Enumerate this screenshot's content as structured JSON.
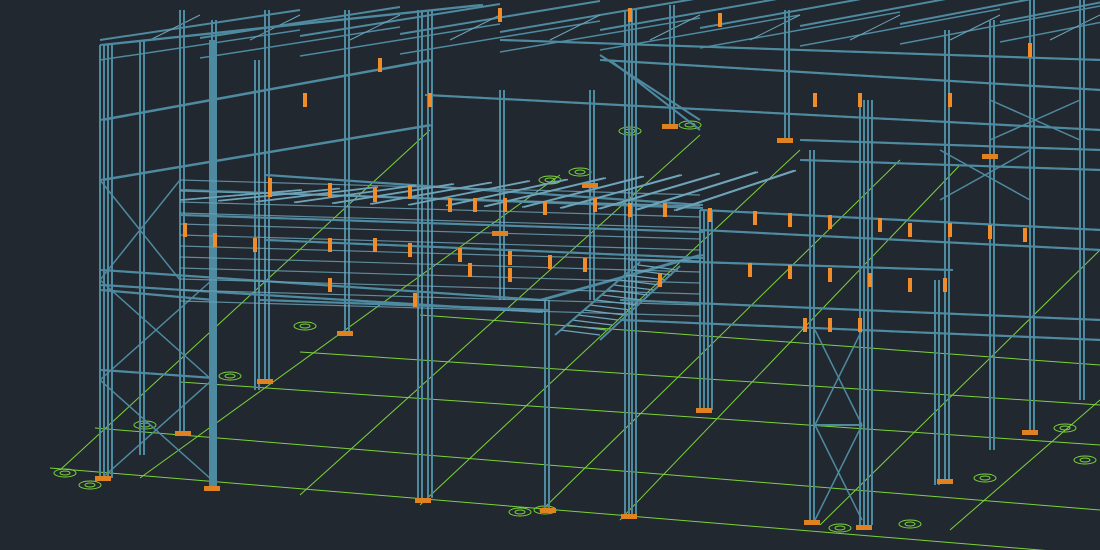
{
  "viewport": {
    "background": "#212830",
    "colors": {
      "steel": "#4e8aa0",
      "steel_light": "#6fa4b8",
      "grid": "#7bd33a",
      "base_plate": "#e0821f",
      "connection": "#f08c2a"
    },
    "layers": [
      "foundation-grid",
      "columns",
      "beams",
      "bracing",
      "mezzanine",
      "stair",
      "roof-trusses",
      "connections"
    ]
  }
}
